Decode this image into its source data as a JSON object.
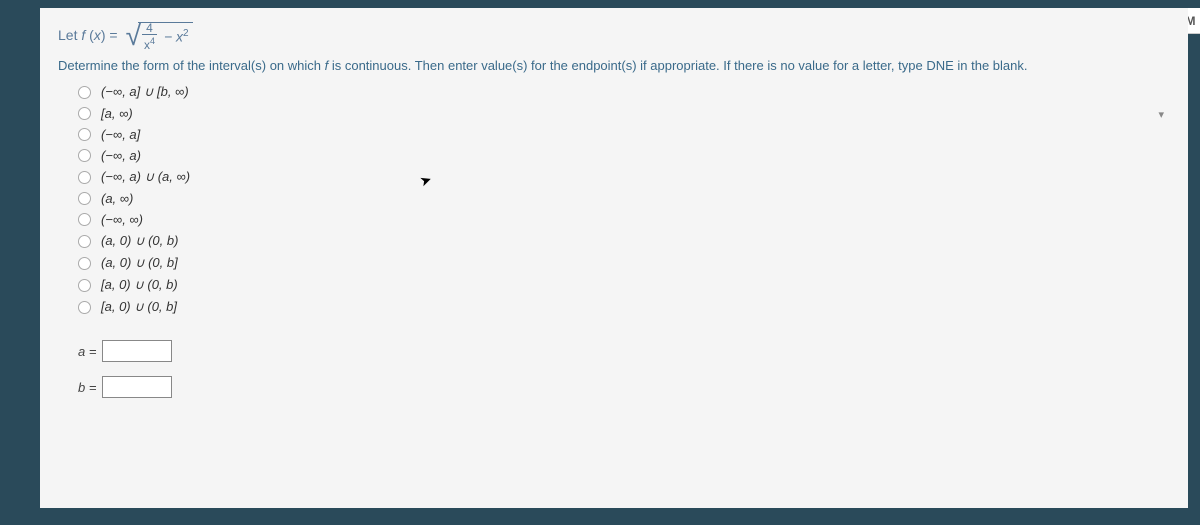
{
  "corner": "M",
  "equation": {
    "prefix": "Let ",
    "func": "f",
    "arg": "x",
    "eq": " = ",
    "frac_num": "4",
    "frac_den_base": "x",
    "frac_den_exp": "4",
    "minus_base": "x",
    "minus_exp": "2"
  },
  "prompt": {
    "before_f": "Determine the form of the interval(s) on which ",
    "f": "f",
    "after_f": " is continuous. Then enter value(s) for the endpoint(s) if appropriate. If there is no value for a letter, type DNE in the blank."
  },
  "options": [
    "(−∞, a] ∪ [b, ∞)",
    "[a, ∞)",
    "(−∞, a]",
    "(−∞, a)",
    "(−∞, a) ∪ (a, ∞)",
    "(a, ∞)",
    "(−∞, ∞)",
    "(a, 0) ∪ (0, b)",
    "(a, 0) ∪ (0, b]",
    "[a, 0) ∪ (0, b)",
    "[a, 0) ∪ (0, b]"
  ],
  "inputs": {
    "a_label": "a =",
    "a_value": "",
    "b_label": "b =",
    "b_value": ""
  },
  "caret": "▾"
}
